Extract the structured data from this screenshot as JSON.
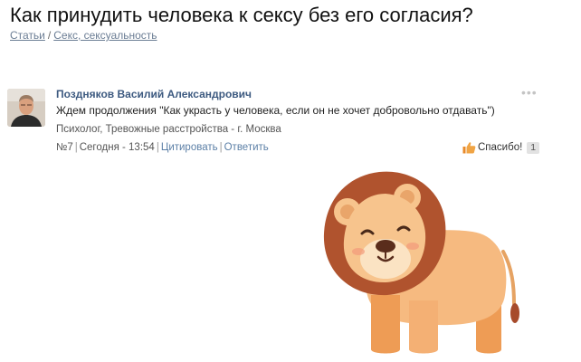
{
  "page": {
    "title": "Как принудить человека к сексу без его согласия?"
  },
  "breadcrumb": {
    "items": [
      "Статьи",
      "Секс, сексуальность"
    ],
    "separator": "/"
  },
  "post": {
    "author": "Поздняков Василий Александрович",
    "avatar_icon": "user-photo",
    "text": "Ждем продолжения \"Как украсть у человека, если он не хочет добровольно отдавать\")",
    "signature": "Психолог, Тревожные расстройства - г. Москва",
    "number": "№7",
    "timestamp": "Сегодня - 13:54",
    "actions": {
      "quote": "Цитировать",
      "reply": "Ответить"
    },
    "more_icon": "ellipsis-icon",
    "thanks": {
      "label": "Спасибо!",
      "count": "1",
      "icon": "thumbs-up-icon"
    }
  },
  "illustration": {
    "icon": "lion-cartoon",
    "colors": {
      "mane": "#b0532e",
      "face": "#f7c48d",
      "body": "#f4b77a",
      "legs": "#eea15b"
    }
  }
}
